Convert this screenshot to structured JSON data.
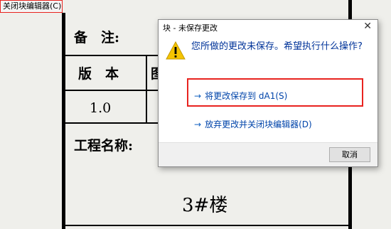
{
  "toolbar": {
    "close_block_editor": "关闭块编辑器(C)"
  },
  "drawing": {
    "remarks": "备　注:",
    "version_header": "版　本",
    "partial_header": "图",
    "version_value": "1.0",
    "project_name": "工程名称:",
    "building": "3#楼"
  },
  "dialog": {
    "title": "块 - 未保存更改",
    "close_glyph": "✕",
    "question": "您所做的更改未保存。希望执行什么操作?",
    "option_save": "将更改保存到 dA1(S)",
    "option_discard": "放弃更改并关闭块编辑器(D)",
    "cancel": "取消",
    "arrow_glyph": "→"
  }
}
